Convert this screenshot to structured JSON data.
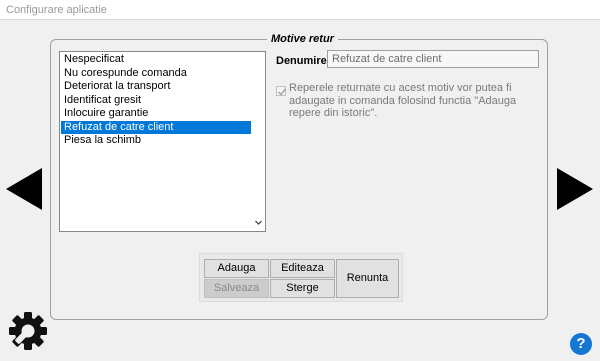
{
  "window": {
    "title": "Configurare aplicatie"
  },
  "group": {
    "legend": "Motive retur"
  },
  "list": {
    "items": [
      "Nespecificat",
      "Nu corespunde comanda",
      "Deteriorat la transport",
      "Identificat gresit",
      "Inlocuire garantie",
      "Refuzat de catre client",
      "Piesa la schimb"
    ],
    "selected_index": 5
  },
  "form": {
    "denumire_label": "Denumire:",
    "denumire_value": "Refuzat de catre client",
    "checkbox_checked": true,
    "checkbox_text": "Reperele returnate cu acest motiv vor putea fi adaugate in comanda folosind functia \"Adauga repere din istoric\"."
  },
  "buttons": {
    "adauga": "Adauga",
    "editeaza": "Editeaza",
    "salveaza": "Salveaza",
    "sterge": "Sterge",
    "renunta": "Renunta"
  },
  "help": {
    "glyph": "?"
  },
  "icons": {
    "nav_left": "triangle-left-icon",
    "nav_right": "triangle-right-icon",
    "settings": "gear-icon",
    "help": "help-icon"
  },
  "colors": {
    "selection": "#0078d7",
    "help": "#1677d2"
  }
}
